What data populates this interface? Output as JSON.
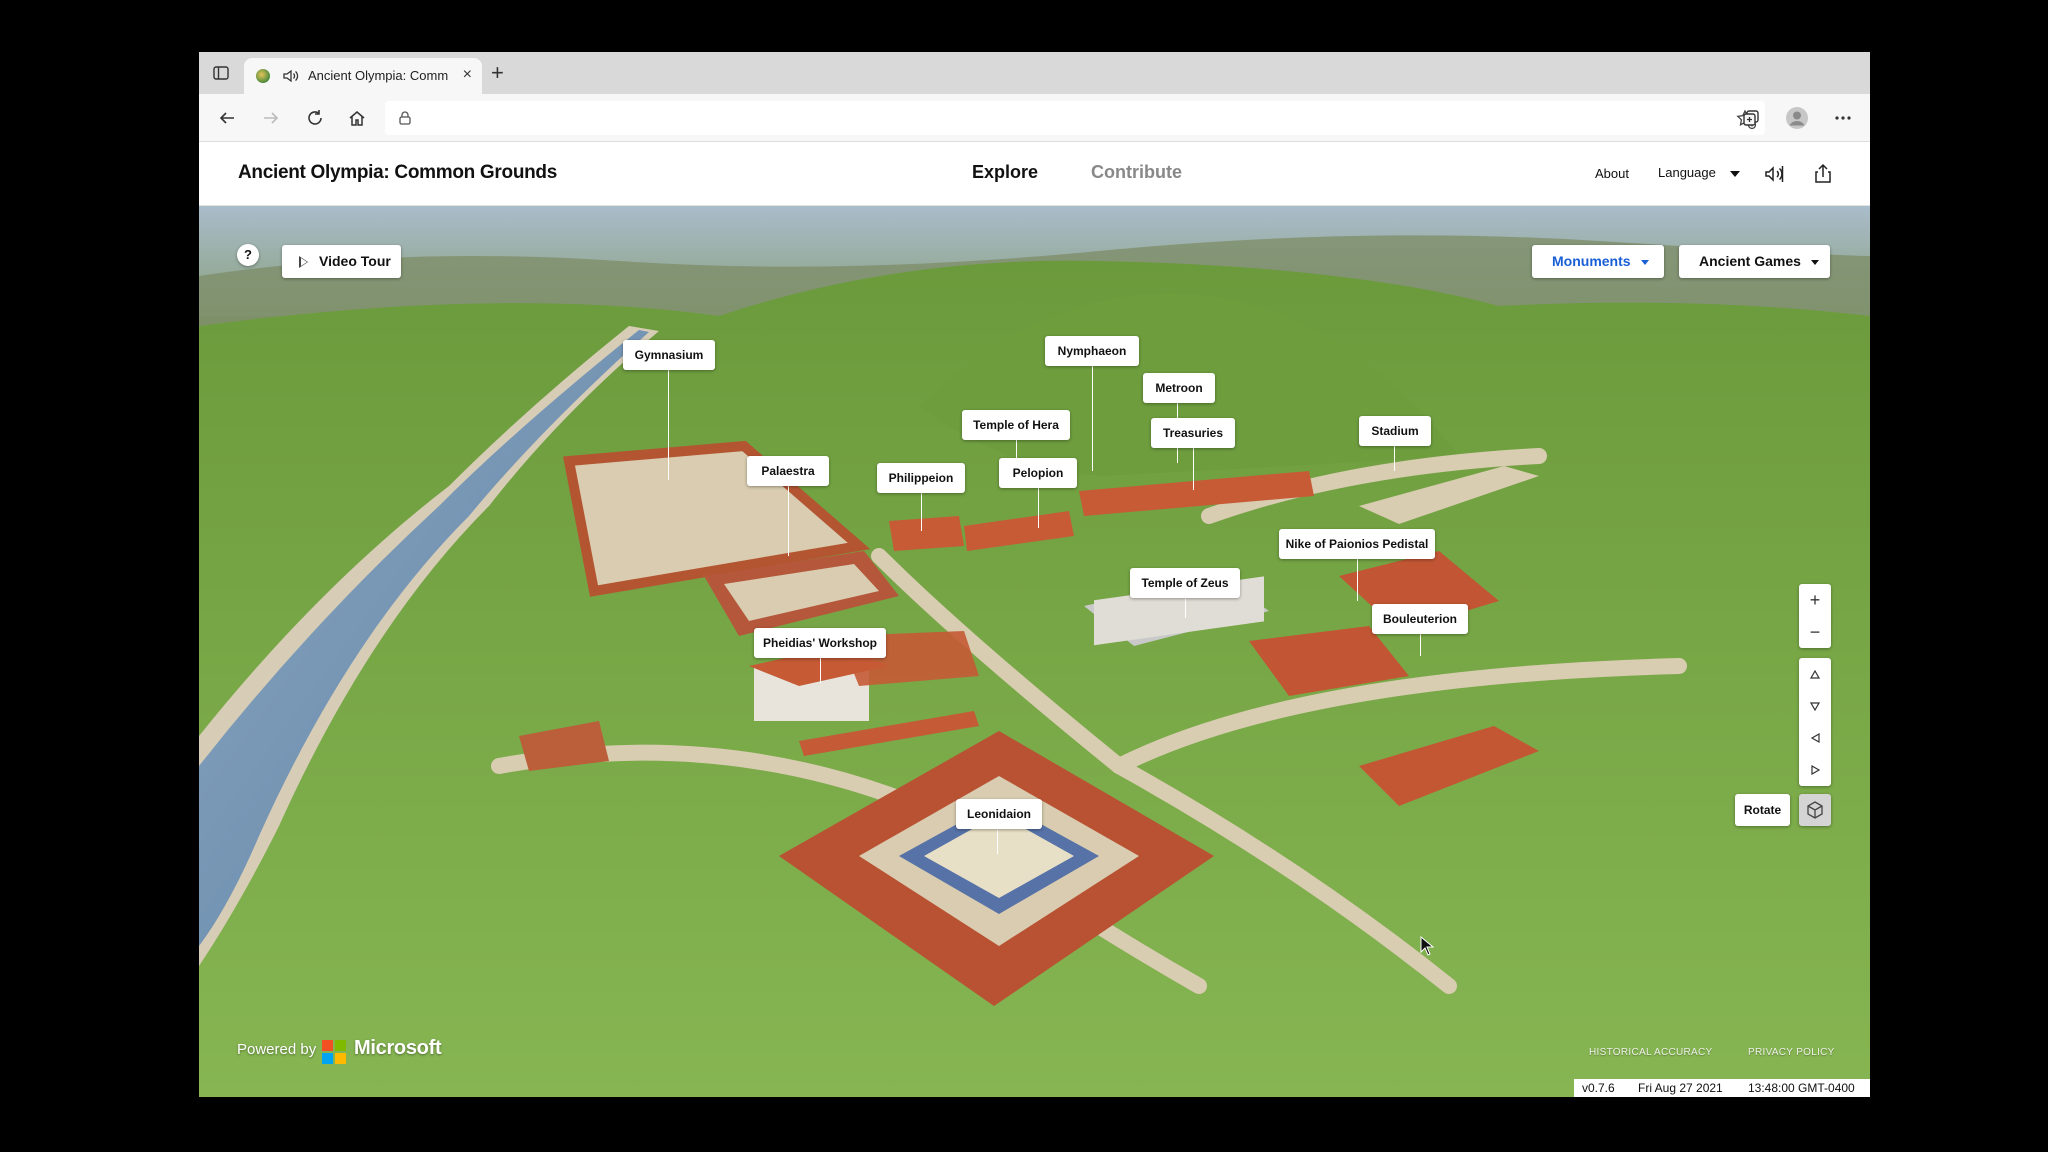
{
  "browser": {
    "tab_title": "Ancient Olympia: Common",
    "tab_close": "×",
    "new_tab": "+",
    "url": ""
  },
  "app": {
    "title": "Ancient Olympia: Common Grounds",
    "nav": {
      "explore": "Explore",
      "contribute": "Contribute"
    },
    "about": "About",
    "language": "Language"
  },
  "map": {
    "help": "?",
    "video_tour": "Video Tour",
    "dropdowns": {
      "monuments": "Monuments",
      "ancient_games": "Ancient Games"
    },
    "labels": {
      "gymnasium": "Gymnasium",
      "nymphaeon": "Nymphaeon",
      "metroon": "Metroon",
      "temple_of_hera": "Temple of Hera",
      "treasuries": "Treasuries",
      "stadium": "Stadium",
      "palaestra": "Palaestra",
      "philippeion": "Philippeion",
      "pelopion": "Pelopion",
      "temple_of_zeus": "Temple of Zeus",
      "nike_of_paionios": "Nike of Paionios Pedistal",
      "bouleuterion": "Bouleuterion",
      "pheidias_workshop": "Pheidias' Workshop",
      "leonidaion": "Leonidaion"
    },
    "controls": {
      "zoom_in": "+",
      "zoom_out": "−",
      "rotate": "Rotate"
    },
    "footer": {
      "powered_by": "Powered by",
      "brand": "Microsoft",
      "historical_accuracy": "HISTORICAL ACCURACY",
      "privacy_policy": "PRIVACY POLICY"
    },
    "status": {
      "version": "v0.7.6",
      "date": "Fri Aug 27 2021",
      "time": "13:48:00 GMT-0400"
    }
  },
  "colors": {
    "accent_blue": "#1a5fd6",
    "roof_terracotta": "#c2522f",
    "grass": "#7fae4c",
    "river": "#6f8fb0"
  },
  "icons": [
    "sidebar-icon",
    "speaker-icon",
    "back-icon",
    "forward-icon",
    "reload-icon",
    "home-icon",
    "lock-icon",
    "favorite-icon",
    "collections-icon",
    "profile-icon",
    "more-icon",
    "read-aloud-icon",
    "share-icon",
    "cube-icon"
  ]
}
